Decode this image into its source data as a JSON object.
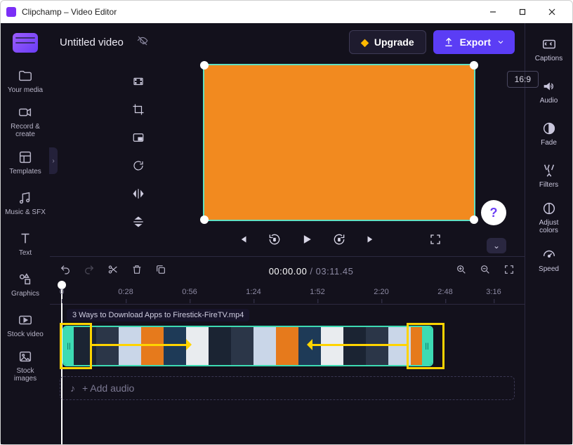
{
  "window": {
    "title": "Clipchamp – Video Editor"
  },
  "project": {
    "title": "Untitled video"
  },
  "header": {
    "upgrade": "Upgrade",
    "export": "Export"
  },
  "aspect_ratio": "16:9",
  "leftnav": {
    "your_media": "Your media",
    "record_create": "Record & create",
    "templates": "Templates",
    "music_sfx": "Music & SFX",
    "text": "Text",
    "graphics": "Graphics",
    "stock_video": "Stock video",
    "stock_images": "Stock images"
  },
  "rightnav": {
    "captions": "Captions",
    "audio": "Audio",
    "fade": "Fade",
    "filters": "Filters",
    "adjust_colors": "Adjust colors",
    "speed": "Speed"
  },
  "playback": {
    "current_time": "00:00.00",
    "total_time": "03:11.45"
  },
  "ruler": {
    "marks": [
      "0",
      "0:28",
      "0:56",
      "1:24",
      "1:52",
      "2:20",
      "2:48",
      "3:16"
    ]
  },
  "clip": {
    "filename": "3 Ways to Download Apps to Firestick-FireTV.mp4"
  },
  "audio_track": {
    "placeholder": "+  Add audio"
  }
}
